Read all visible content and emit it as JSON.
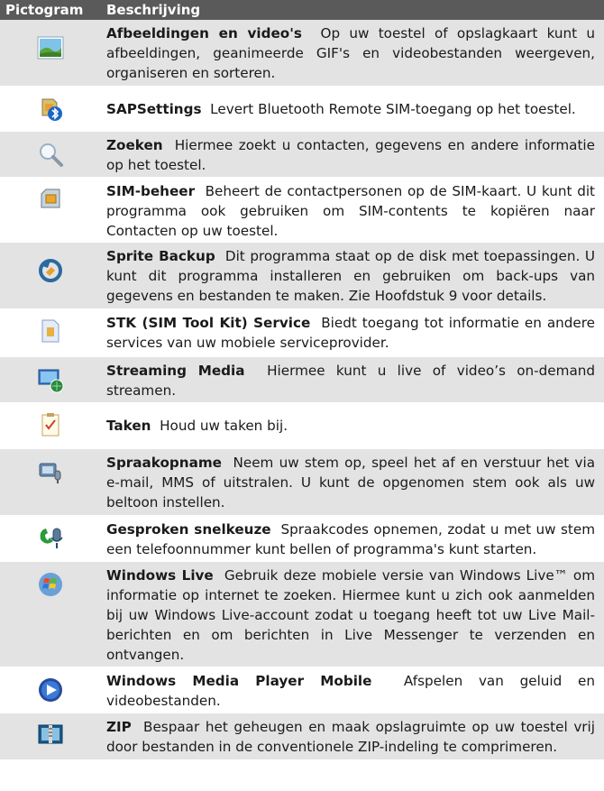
{
  "header": {
    "col1": "Pictogram",
    "col2": "Beschrijving"
  },
  "rows": [
    {
      "title": "Afbeeldingen en video's",
      "desc": "Op uw toestel of opslagkaart kunt u afbeeldingen, geanimeerde GIF's en videobestanden weergeven, organiseren en sorteren.",
      "icon": "pictures-videos-icon"
    },
    {
      "title": "SAPSettings",
      "desc": "Levert Bluetooth Remote SIM-toegang op het toestel.",
      "icon": "bluetooth-sim-icon"
    },
    {
      "title": "Zoeken",
      "desc": "Hiermee zoekt u contacten, gegevens en andere informatie op het toestel.",
      "icon": "magnifier-icon"
    },
    {
      "title": "SIM-beheer",
      "desc": "Beheert de contactpersonen op de SIM-kaart. U kunt dit programma ook gebruiken om SIM-contents te kopiëren naar Contacten op uw toestel.",
      "icon": "sim-card-icon"
    },
    {
      "title": "Sprite Backup",
      "desc": "Dit programma staat op de disk met toepassingen. U kunt dit programma installeren en gebruiken om back-ups van gegevens en bestanden te maken. Zie Hoofdstuk 9 voor details.",
      "icon": "backup-icon"
    },
    {
      "title": "STK (SIM Tool Kit) Service",
      "desc": "Biedt toegang tot informatie en andere services van uw mobiele serviceprovider.",
      "icon": "stk-icon"
    },
    {
      "title": "Streaming Media",
      "desc": "Hiermee kunt u live of video’s on-demand streamen.",
      "icon": "streaming-media-icon"
    },
    {
      "title": "Taken",
      "desc": "Houd uw taken bij.",
      "icon": "tasks-icon"
    },
    {
      "title": "Spraakopname",
      "desc": "Neem uw stem op, speel het af en verstuur het via e-mail, MMS of uitstralen. U kunt de opgenomen stem ook als uw beltoon instellen.",
      "icon": "voice-recorder-icon"
    },
    {
      "title": "Gesproken snelkeuze",
      "desc": "Spraakcodes opnemen, zodat u met uw stem een telefoonnummer kunt bellen of programma's kunt starten.",
      "icon": "voice-speed-dial-icon"
    },
    {
      "title": "Windows Live",
      "desc": "Gebruik deze mobiele versie van Windows Live™ om informatie op internet te zoeken. Hiermee kunt u zich ook aanmelden bij uw Windows Live-account zodat u toegang heeft tot uw Live Mail-berichten en om berichten in Live Messenger te verzenden en ontvangen.",
      "icon": "windows-live-icon"
    },
    {
      "title": "Windows Media Player Mobile",
      "desc": "Afspelen van geluid en videobestanden.",
      "icon": "media-player-icon"
    },
    {
      "title": "ZIP",
      "desc": "Bespaar het geheugen en maak opslagruimte op uw toestel vrij door bestanden in de conventionele ZIP-indeling te comprimeren.",
      "icon": "zip-icon"
    }
  ]
}
